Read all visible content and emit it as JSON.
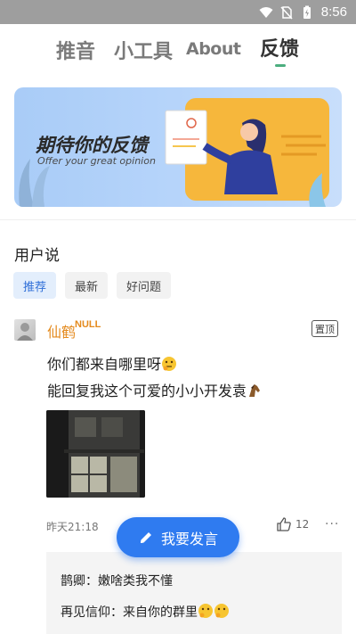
{
  "status_bar": {
    "time": "8:56",
    "icons": [
      "wifi-icon",
      "no-sim-icon",
      "battery-charging-icon"
    ]
  },
  "tabs": [
    {
      "label": "推音",
      "active": false
    },
    {
      "label": "小工具",
      "active": false
    },
    {
      "label": "About",
      "active": false
    },
    {
      "label": "反馈",
      "active": true
    }
  ],
  "banner": {
    "title": "期待你的反馈",
    "subtitle": "Offer your great opinion"
  },
  "section": {
    "title": "用户说"
  },
  "filters": [
    {
      "label": "推荐",
      "active": true
    },
    {
      "label": "最新",
      "active": false
    },
    {
      "label": "好问题",
      "active": false
    }
  ],
  "post": {
    "author": "仙鹤",
    "author_badge": "NULL",
    "pinned_label": "置顶",
    "lines": [
      "你们都来自哪里呀",
      "能回复我这个可爱的小小开发袁"
    ],
    "timestamp": "昨天21:18",
    "likes": "12",
    "more_label": "···",
    "replies": [
      {
        "text": "鹊卿：嫩啥类我不懂"
      },
      {
        "text": "再见信仰：来自你的群里"
      }
    ]
  },
  "fab": {
    "label": "我要发言"
  },
  "colors": {
    "accent": "#2f7bf0",
    "author": "#e48a1d",
    "tab_indicator": "#4cae7f"
  }
}
